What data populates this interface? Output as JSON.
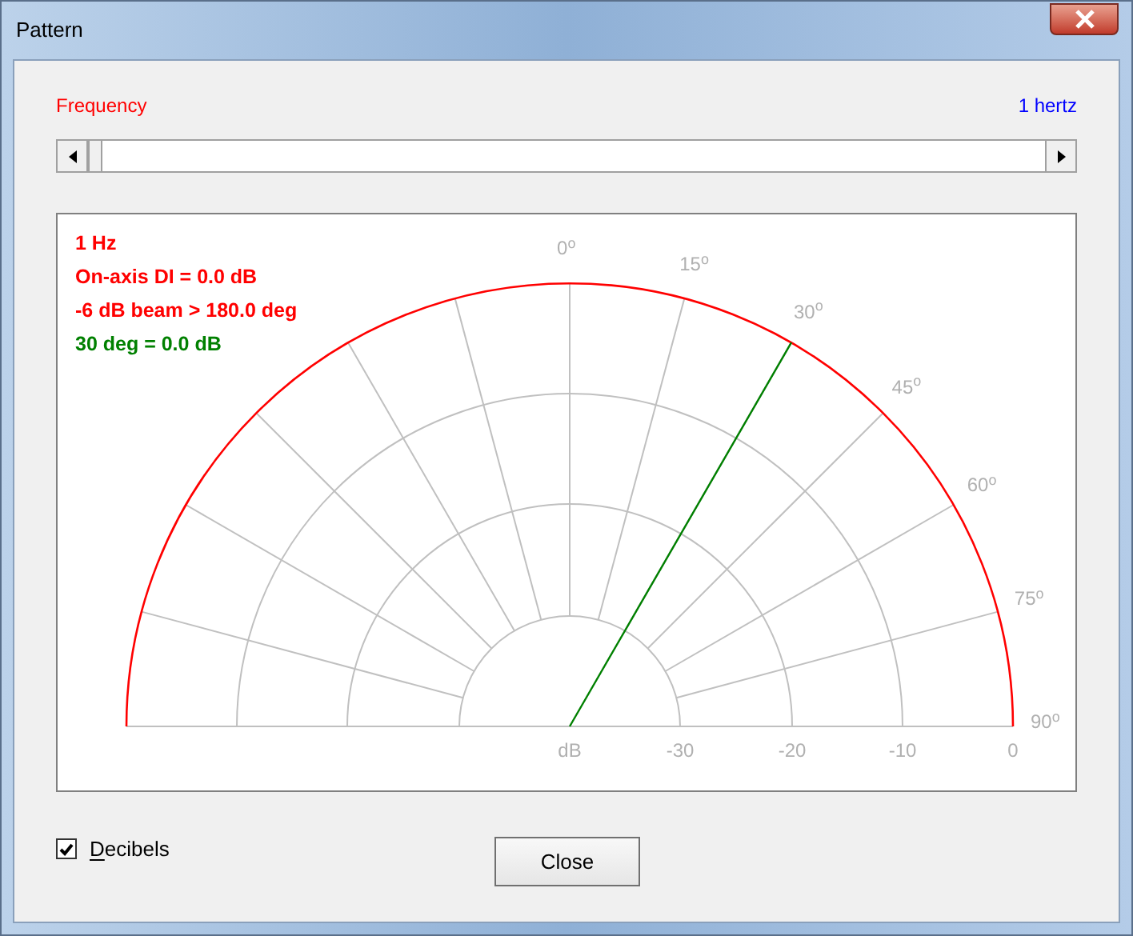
{
  "window": {
    "title": "Pattern"
  },
  "frequency": {
    "label": "Frequency",
    "reading": "1 hertz",
    "slider": {
      "level": 0
    }
  },
  "plot": {
    "readouts": [
      {
        "text": "1 Hz",
        "color": "#ff0000"
      },
      {
        "text": "On-axis DI = 0.0 dB",
        "color": "#ff0000"
      },
      {
        "text": "-6 dB beam > 180.0 deg",
        "color": "#ff0000"
      },
      {
        "text": "30 deg = 0.0 dB",
        "color": "#008000"
      }
    ],
    "angle_labels": [
      "0$^{o}$",
      "15$^{o}$",
      "30$^{o}$",
      "45$^{o}$",
      "60$^{o}$",
      "75$^{o}$",
      "90$^{o}$"
    ],
    "radial_labels": [
      "dB",
      "-30",
      "-20",
      "-10",
      "0"
    ]
  },
  "decibels": {
    "label": "Decibels",
    "checked": true
  },
  "buttons": [
    {
      "label": "Close"
    }
  ]
}
